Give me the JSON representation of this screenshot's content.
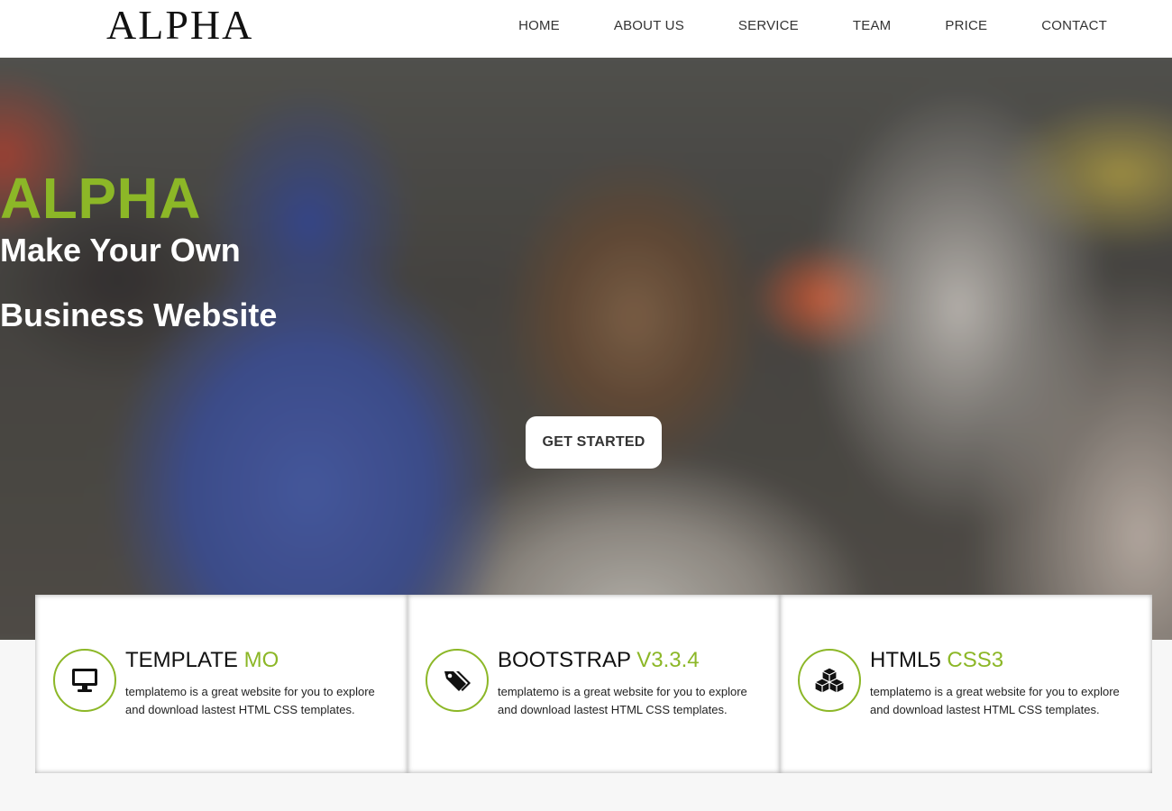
{
  "header": {
    "logo": "ALPHA",
    "nav": [
      "HOME",
      "ABOUT US",
      "SERVICE",
      "TEAM",
      "PRICE",
      "CONTACT"
    ]
  },
  "hero": {
    "brand": "ALPHA",
    "line1": "Make Your Own",
    "line2": "Business Website",
    "cta": "GET STARTED"
  },
  "features": [
    {
      "title": "TEMPLATE",
      "title_accent": "MO",
      "icon": "monitor-icon",
      "text": "templatemo is a great website for you to explore and download lastest HTML CSS templates."
    },
    {
      "title": "BOOTSTRAP",
      "title_accent": "V3.3.4",
      "icon": "tags-icon",
      "text": "templatemo is a great website for you to explore and download lastest HTML CSS templates."
    },
    {
      "title": "HTML5",
      "title_accent": "CSS3",
      "icon": "cubes-icon",
      "text": "templatemo is a great website for you to explore and download lastest HTML CSS templates."
    }
  ],
  "colors": {
    "accent": "#8cb727",
    "header_bg": "#ffffff",
    "page_bg": "#f7f7f7",
    "button_bg": "#ffffff"
  }
}
